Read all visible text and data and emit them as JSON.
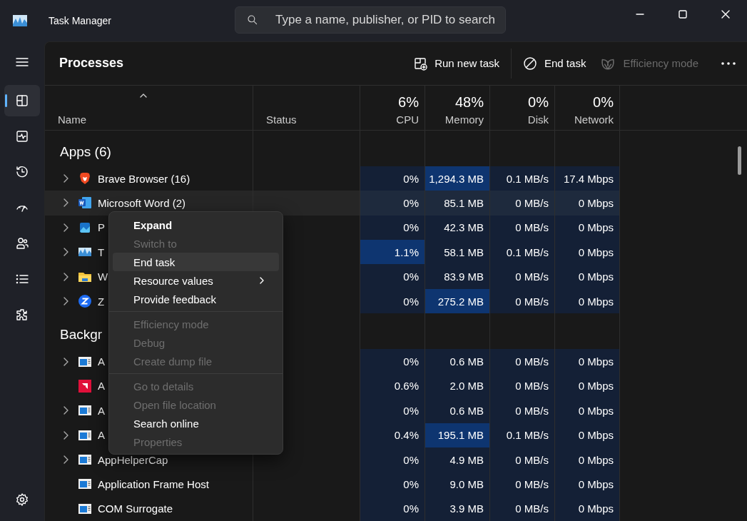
{
  "window": {
    "title": "Task Manager"
  },
  "search": {
    "placeholder": "Type a name, publisher, or PID to search"
  },
  "sidebar": {
    "items": [
      {
        "kind": "processes",
        "selected": true
      },
      {
        "kind": "performance",
        "selected": false
      },
      {
        "kind": "history",
        "selected": false
      },
      {
        "kind": "startup",
        "selected": false
      },
      {
        "kind": "users",
        "selected": false
      },
      {
        "kind": "details",
        "selected": false
      },
      {
        "kind": "services",
        "selected": false
      }
    ]
  },
  "page": {
    "title": "Processes"
  },
  "toolbar": [
    {
      "kind": "run",
      "label": "Run new task",
      "disabled": false
    },
    {
      "kind": "end",
      "label": "End task",
      "disabled": false
    },
    {
      "kind": "efficiency",
      "label": "Efficiency mode",
      "disabled": true
    }
  ],
  "table": {
    "columns": [
      {
        "label": "Name"
      },
      {
        "label": "Status"
      },
      {
        "label": "CPU",
        "total": "6%"
      },
      {
        "label": "Memory",
        "total": "48%"
      },
      {
        "label": "Disk",
        "total": "0%"
      },
      {
        "label": "Network",
        "total": "0%"
      }
    ],
    "groups": [
      {
        "title": "Apps (6)",
        "rows": [
          {
            "name": "Brave Browser (16)",
            "kind": "brave",
            "expandable": true,
            "highlighted": false,
            "cells": [
              {
                "value": "0%",
                "high": false
              },
              {
                "value": "1,294.3 MB",
                "high": true
              },
              {
                "value": "0.1 MB/s",
                "high": false
              },
              {
                "value": "17.4 Mbps",
                "high": false
              }
            ]
          },
          {
            "name": "Microsoft Word (2)",
            "kind": "word",
            "expandable": true,
            "highlighted": true,
            "cells": [
              {
                "value": "0%",
                "high": false
              },
              {
                "value": "85.1 MB",
                "high": false
              },
              {
                "value": "0 MB/s",
                "high": false
              },
              {
                "value": "0 Mbps",
                "high": false
              }
            ]
          },
          {
            "name": "P",
            "kind": "photos",
            "expandable": true,
            "highlighted": false,
            "cells": [
              {
                "value": "0%",
                "high": false
              },
              {
                "value": "42.3 MB",
                "high": false
              },
              {
                "value": "0 MB/s",
                "high": false
              },
              {
                "value": "0 Mbps",
                "high": false
              }
            ]
          },
          {
            "name": "T",
            "kind": "taskmgr",
            "expandable": true,
            "highlighted": false,
            "cells": [
              {
                "value": "1.1%",
                "high": true
              },
              {
                "value": "58.1 MB",
                "high": false
              },
              {
                "value": "0.1 MB/s",
                "high": false
              },
              {
                "value": "0 Mbps",
                "high": false
              }
            ]
          },
          {
            "name": "W",
            "kind": "folder",
            "expandable": true,
            "highlighted": false,
            "cells": [
              {
                "value": "0%",
                "high": false
              },
              {
                "value": "83.9 MB",
                "high": false
              },
              {
                "value": "0 MB/s",
                "high": false
              },
              {
                "value": "0 Mbps",
                "high": false
              }
            ]
          },
          {
            "name": "Z",
            "kind": "zoom",
            "expandable": true,
            "highlighted": false,
            "cells": [
              {
                "value": "0%",
                "high": false
              },
              {
                "value": "275.2 MB",
                "high": true
              },
              {
                "value": "0 MB/s",
                "high": false
              },
              {
                "value": "0 Mbps",
                "high": false
              }
            ]
          }
        ]
      },
      {
        "title": "Backgr",
        "rows": [
          {
            "name": "A",
            "kind": "app",
            "expandable": true,
            "highlighted": false,
            "cells": [
              {
                "value": "0%",
                "high": false
              },
              {
                "value": "0.6 MB",
                "high": false
              },
              {
                "value": "0 MB/s",
                "high": false
              },
              {
                "value": "0 Mbps",
                "high": false
              }
            ]
          },
          {
            "name": "A",
            "kind": "amd",
            "expandable": false,
            "highlighted": false,
            "cells": [
              {
                "value": "0.6%",
                "high": false
              },
              {
                "value": "2.0 MB",
                "high": false
              },
              {
                "value": "0 MB/s",
                "high": false
              },
              {
                "value": "0 Mbps",
                "high": false
              }
            ]
          },
          {
            "name": "A",
            "kind": "app",
            "expandable": true,
            "highlighted": false,
            "cells": [
              {
                "value": "0%",
                "high": false
              },
              {
                "value": "0.6 MB",
                "high": false
              },
              {
                "value": "0 MB/s",
                "high": false
              },
              {
                "value": "0 Mbps",
                "high": false
              }
            ]
          },
          {
            "name": "A",
            "kind": "app",
            "expandable": true,
            "highlighted": false,
            "cells": [
              {
                "value": "0.4%",
                "high": false
              },
              {
                "value": "195.1 MB",
                "high": true
              },
              {
                "value": "0.1 MB/s",
                "high": false
              },
              {
                "value": "0 Mbps",
                "high": false
              }
            ]
          },
          {
            "name": "AppHelperCap",
            "kind": "app",
            "expandable": true,
            "highlighted": false,
            "cells": [
              {
                "value": "0%",
                "high": false
              },
              {
                "value": "4.9 MB",
                "high": false
              },
              {
                "value": "0 MB/s",
                "high": false
              },
              {
                "value": "0 Mbps",
                "high": false
              }
            ]
          },
          {
            "name": "Application Frame Host",
            "kind": "app",
            "expandable": false,
            "highlighted": false,
            "cells": [
              {
                "value": "0%",
                "high": false
              },
              {
                "value": "9.0 MB",
                "high": false
              },
              {
                "value": "0 MB/s",
                "high": false
              },
              {
                "value": "0 Mbps",
                "high": false
              }
            ]
          },
          {
            "name": "COM Surrogate",
            "kind": "app",
            "expandable": false,
            "highlighted": false,
            "cells": [
              {
                "value": "0%",
                "high": false
              },
              {
                "value": "3.9 MB",
                "high": false
              },
              {
                "value": "0 MB/s",
                "high": false
              },
              {
                "value": "0 Mbps",
                "high": false
              }
            ]
          }
        ]
      }
    ]
  },
  "menu": {
    "groups": [
      {
        "items": [
          {
            "label": "Expand",
            "default": true,
            "disabled": false,
            "selected": false,
            "submenu": false
          },
          {
            "label": "Switch to",
            "default": false,
            "disabled": true,
            "selected": false,
            "submenu": false
          },
          {
            "label": "End task",
            "default": false,
            "disabled": false,
            "selected": true,
            "submenu": false
          },
          {
            "label": "Resource values",
            "default": false,
            "disabled": false,
            "selected": false,
            "submenu": true
          },
          {
            "label": "Provide feedback",
            "default": false,
            "disabled": false,
            "selected": false,
            "submenu": false
          }
        ]
      },
      {
        "items": [
          {
            "label": "Efficiency mode",
            "default": false,
            "disabled": true,
            "selected": false,
            "submenu": false
          },
          {
            "label": "Debug",
            "default": false,
            "disabled": true,
            "selected": false,
            "submenu": false
          },
          {
            "label": "Create dump file",
            "default": false,
            "disabled": true,
            "selected": false,
            "submenu": false
          }
        ]
      },
      {
        "items": [
          {
            "label": "Go to details",
            "default": false,
            "disabled": true,
            "selected": false,
            "submenu": false
          },
          {
            "label": "Open file location",
            "default": false,
            "disabled": true,
            "selected": false,
            "submenu": false
          },
          {
            "label": "Search online",
            "default": false,
            "disabled": false,
            "selected": false,
            "submenu": false
          },
          {
            "label": "Properties",
            "default": false,
            "disabled": true,
            "selected": false,
            "submenu": false
          }
        ]
      }
    ]
  }
}
